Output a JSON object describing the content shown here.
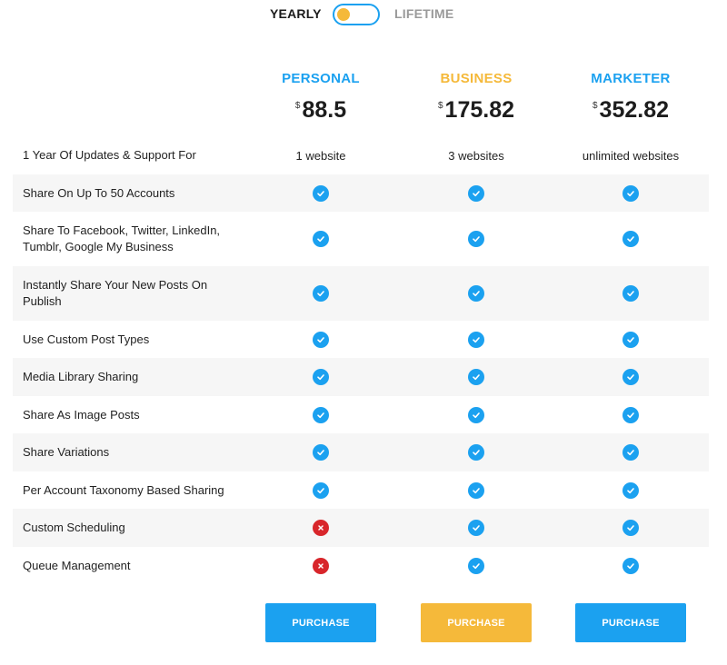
{
  "toggle": {
    "yearly_label": "YEARLY",
    "lifetime_label": "LIFETIME",
    "selected": "yearly"
  },
  "plans": [
    {
      "name": "PERSONAL",
      "currency": "$",
      "price": "88.5",
      "color": "#1ba1f0"
    },
    {
      "name": "BUSINESS",
      "currency": "$",
      "price": "175.82",
      "color": "#f5b93a"
    },
    {
      "name": "MARKETER",
      "currency": "$",
      "price": "352.82",
      "color": "#1ba1f0"
    }
  ],
  "features": [
    {
      "label": "1 Year Of Updates & Support For",
      "values": [
        "1 website",
        "3 websites",
        "unlimited websites"
      ]
    },
    {
      "label": "Share On Up To 50 Accounts",
      "values": [
        "check",
        "check",
        "check"
      ]
    },
    {
      "label": "Share To Facebook, Twitter, LinkedIn, Tumblr, Google My Business",
      "values": [
        "check",
        "check",
        "check"
      ]
    },
    {
      "label": "Instantly Share Your New Posts On Publish",
      "values": [
        "check",
        "check",
        "check"
      ]
    },
    {
      "label": "Use Custom Post Types",
      "values": [
        "check",
        "check",
        "check"
      ]
    },
    {
      "label": "Media Library Sharing",
      "values": [
        "check",
        "check",
        "check"
      ]
    },
    {
      "label": "Share As Image Posts",
      "values": [
        "check",
        "check",
        "check"
      ]
    },
    {
      "label": "Share Variations",
      "values": [
        "check",
        "check",
        "check"
      ]
    },
    {
      "label": "Per Account Taxonomy Based Sharing",
      "values": [
        "check",
        "check",
        "check"
      ]
    },
    {
      "label": "Custom Scheduling",
      "values": [
        "cross",
        "check",
        "check"
      ]
    },
    {
      "label": "Queue Management",
      "values": [
        "cross",
        "check",
        "check"
      ]
    }
  ],
  "buttons": [
    {
      "label": "PURCHASE",
      "color": "#1ba1f0"
    },
    {
      "label": "PURCHASE",
      "color": "#f5b93a"
    },
    {
      "label": "PURCHASE",
      "color": "#1ba1f0"
    }
  ]
}
